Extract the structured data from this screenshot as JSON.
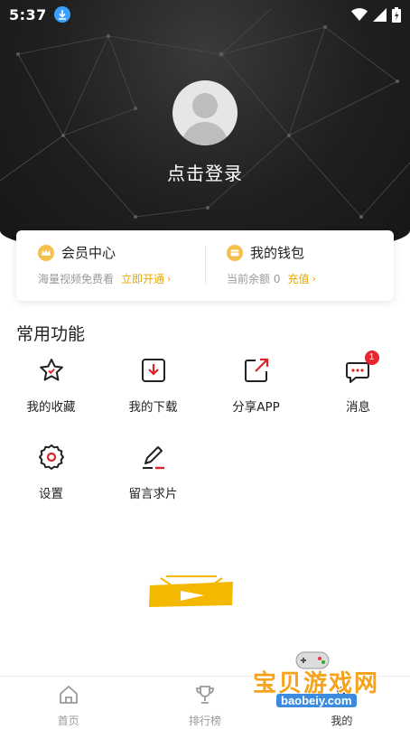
{
  "status_bar": {
    "time": "5:37"
  },
  "profile": {
    "login_text": "点击登录"
  },
  "member_card": {
    "vip": {
      "title": "会员中心",
      "subtitle": "海量视频免费看",
      "action": "立即开通"
    },
    "wallet": {
      "title": "我的钱包",
      "subtitle": "当前余额 0",
      "action": "充值"
    }
  },
  "functions": {
    "title": "常用功能",
    "items": [
      {
        "label": "我的收藏",
        "icon": "star-icon"
      },
      {
        "label": "我的下载",
        "icon": "download-icon"
      },
      {
        "label": "分享APP",
        "icon": "share-icon"
      },
      {
        "label": "消息",
        "icon": "message-icon",
        "badge": "1"
      },
      {
        "label": "设置",
        "icon": "gear-icon"
      },
      {
        "label": "留言求片",
        "icon": "edit-icon"
      }
    ]
  },
  "tabs": [
    {
      "label": "首页",
      "icon": "home-icon"
    },
    {
      "label": "排行榜",
      "icon": "trophy-icon"
    },
    {
      "label": "我的",
      "icon": "user-icon"
    }
  ],
  "watermark": {
    "text": "宝贝游戏网",
    "url": "baobeiy.com"
  },
  "colors": {
    "accent": "#e8a800",
    "header_bg": "#1f1f1f",
    "badge": "#e8262f",
    "icon_red": "#d9262c"
  }
}
